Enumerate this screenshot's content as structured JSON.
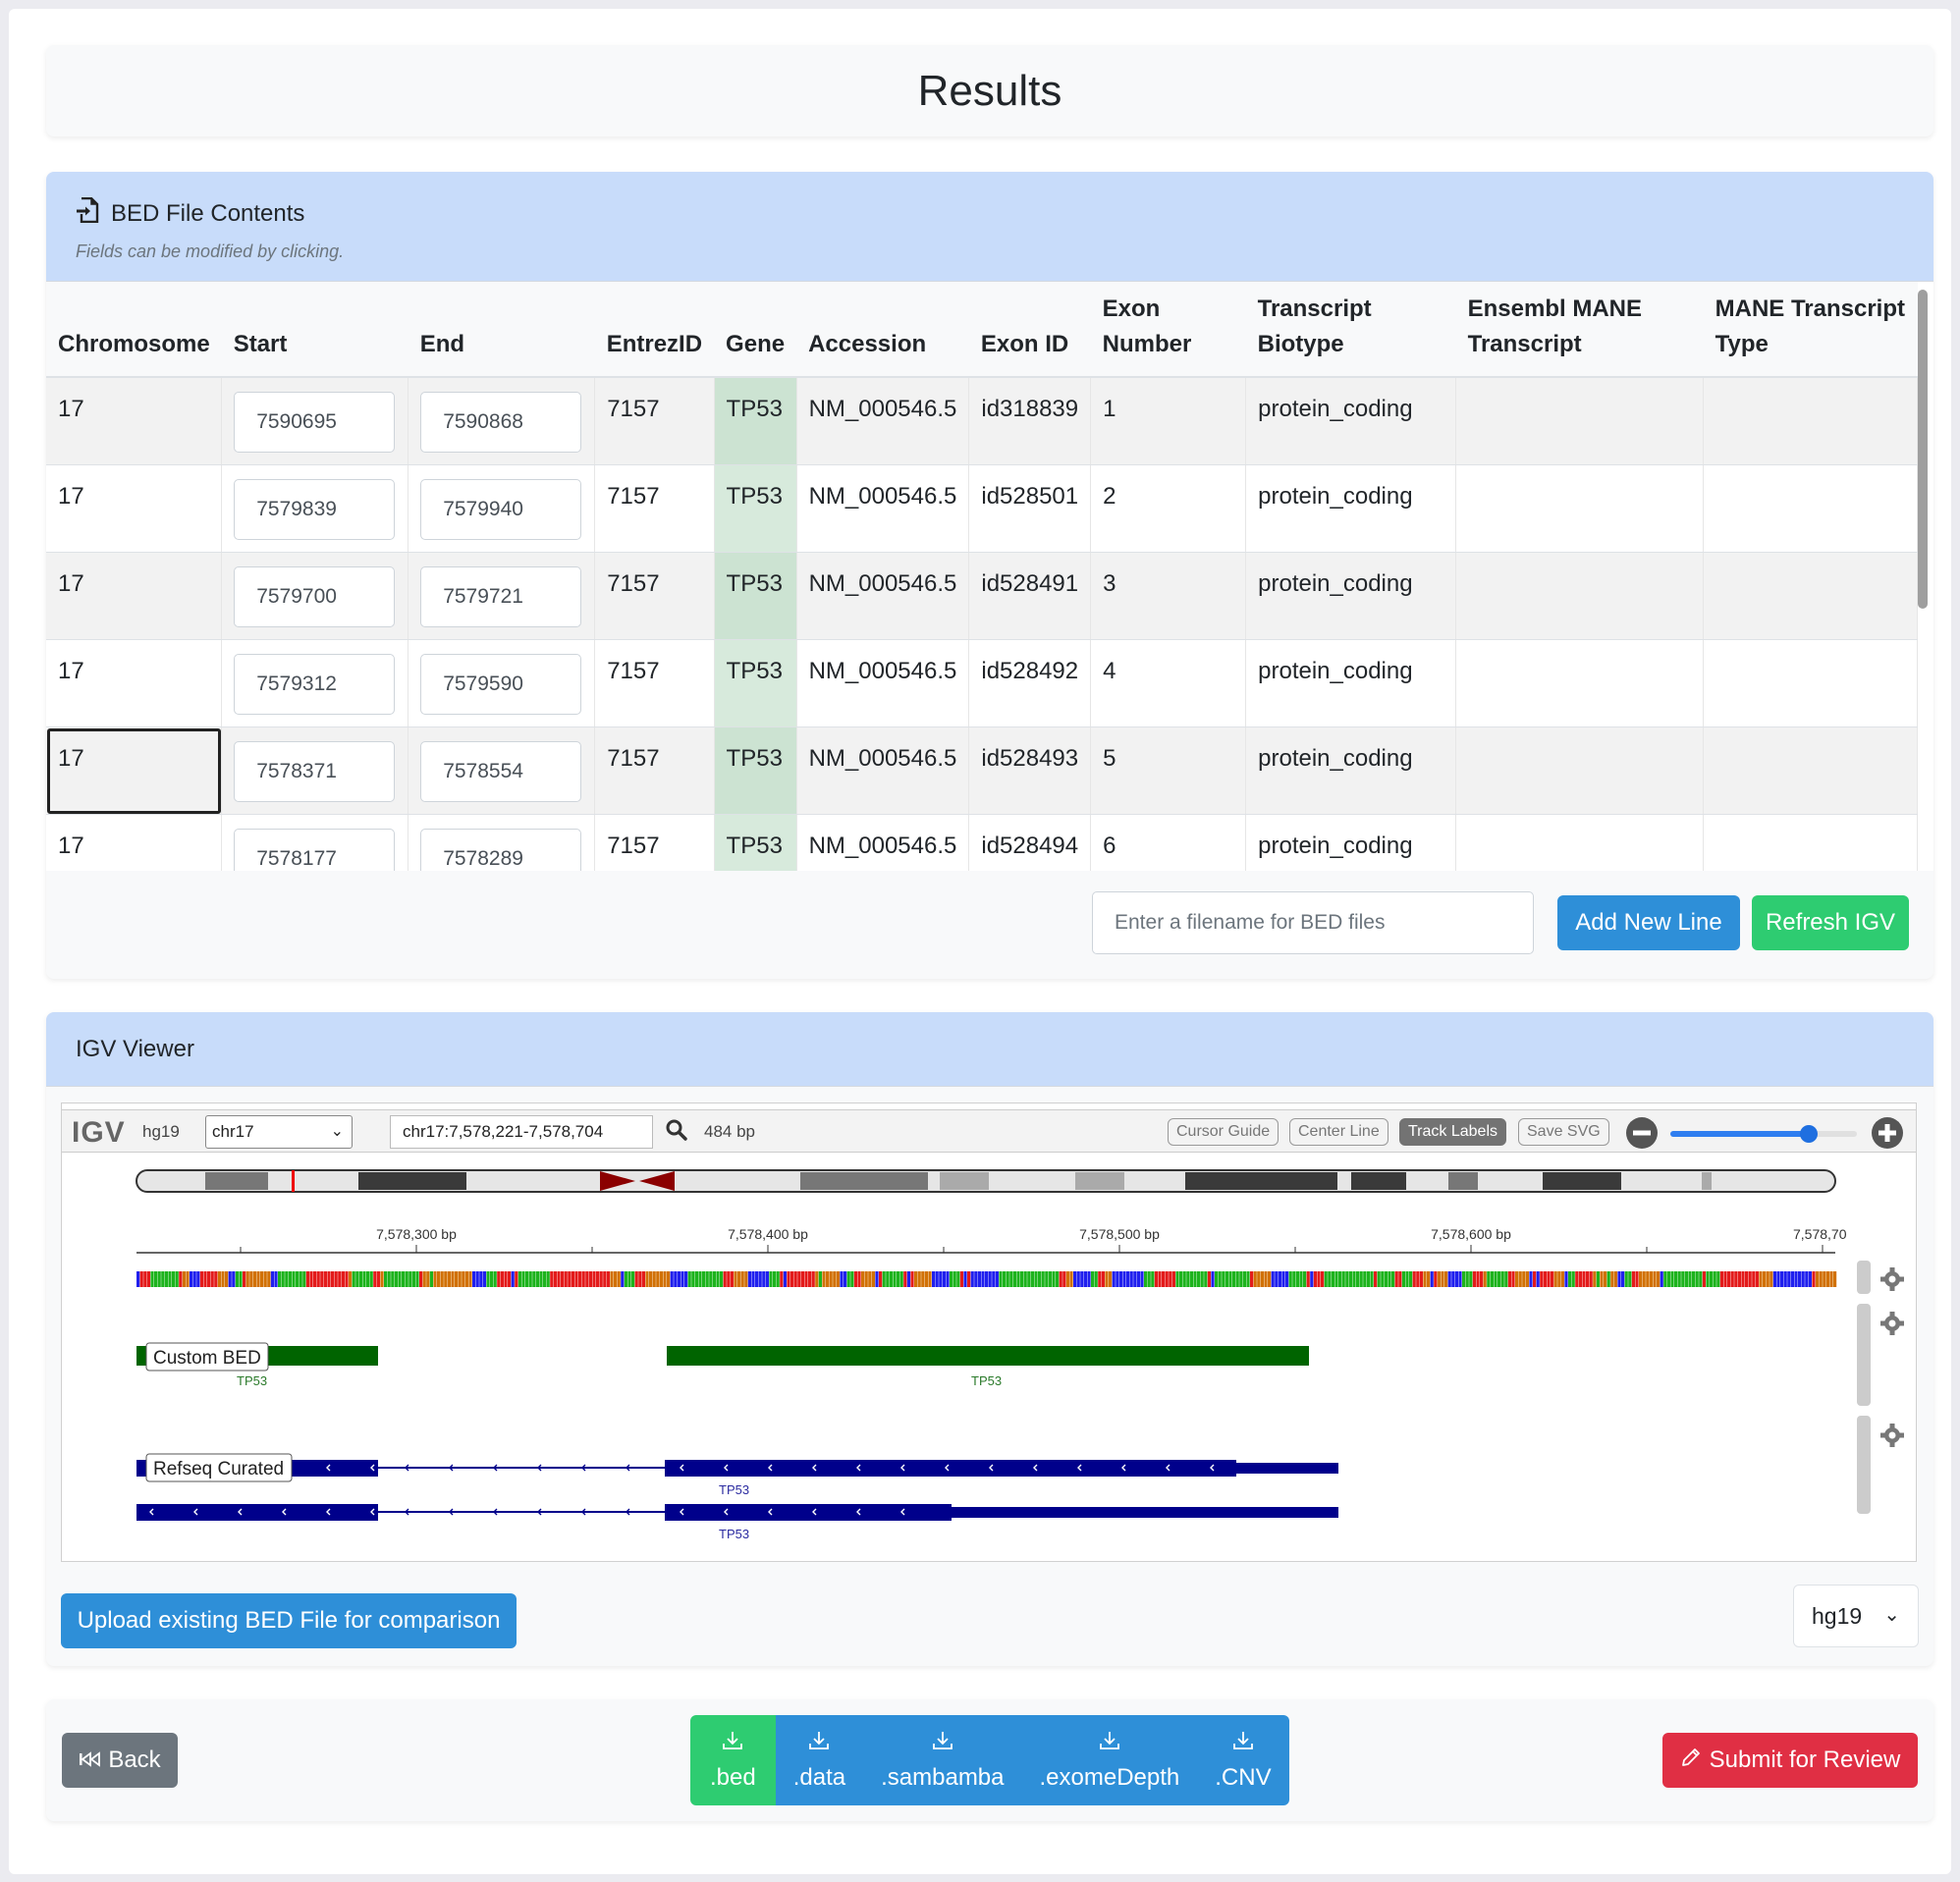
{
  "page_title": "Results",
  "bed": {
    "header_title": "BED File Contents",
    "header_subtitle": "Fields can be modified by clicking.",
    "columns": [
      "Chromosome",
      "Start",
      "End",
      "EntrezID",
      "Gene",
      "Accession",
      "Exon ID",
      "Exon Number",
      "Transcript Biotype",
      "Ensembl MANE Transcript",
      "MANE Transcript Type"
    ],
    "columns_wrapped": {
      "exon_number": [
        "Exon",
        "Number"
      ],
      "transcript_biotype": [
        "Transcript",
        "Biotype"
      ],
      "ensembl_mane": [
        "Ensembl MANE",
        "Transcript"
      ],
      "mane_type": [
        "MANE Transcript",
        "Type"
      ]
    },
    "rows": [
      {
        "chromosome": "17",
        "start": "7590695",
        "end": "7590868",
        "entrez": "7157",
        "gene": "TP53",
        "accession": "NM_000546.5",
        "exon_id": "id318839",
        "exon_number": "1",
        "biotype": "protein_coding",
        "ensembl_mane": "",
        "mane_type": ""
      },
      {
        "chromosome": "17",
        "start": "7579839",
        "end": "7579940",
        "entrez": "7157",
        "gene": "TP53",
        "accession": "NM_000546.5",
        "exon_id": "id528501",
        "exon_number": "2",
        "biotype": "protein_coding",
        "ensembl_mane": "",
        "mane_type": ""
      },
      {
        "chromosome": "17",
        "start": "7579700",
        "end": "7579721",
        "entrez": "7157",
        "gene": "TP53",
        "accession": "NM_000546.5",
        "exon_id": "id528491",
        "exon_number": "3",
        "biotype": "protein_coding",
        "ensembl_mane": "",
        "mane_type": ""
      },
      {
        "chromosome": "17",
        "start": "7579312",
        "end": "7579590",
        "entrez": "7157",
        "gene": "TP53",
        "accession": "NM_000546.5",
        "exon_id": "id528492",
        "exon_number": "4",
        "biotype": "protein_coding",
        "ensembl_mane": "",
        "mane_type": ""
      },
      {
        "chromosome": "17",
        "start": "7578371",
        "end": "7578554",
        "entrez": "7157",
        "gene": "TP53",
        "accession": "NM_000546.5",
        "exon_id": "id528493",
        "exon_number": "5",
        "biotype": "protein_coding",
        "ensembl_mane": "",
        "mane_type": ""
      },
      {
        "chromosome": "17",
        "start": "7578177",
        "end": "7578289",
        "entrez": "7157",
        "gene": "TP53",
        "accession": "NM_000546.5",
        "exon_id": "id528494",
        "exon_number": "6",
        "biotype": "protein_coding",
        "ensembl_mane": "",
        "mane_type": ""
      }
    ],
    "filename_placeholder": "Enter a filename for BED files",
    "add_line_label": "Add New Line",
    "refresh_igv_label": "Refresh IGV"
  },
  "igv": {
    "header_title": "IGV Viewer",
    "logo": "IGV",
    "genome": "hg19",
    "chromosome": "chr17",
    "locus": "chr17:7,578,221-7,578,704",
    "width_label": "484 bp",
    "buttons": [
      "Cursor Guide",
      "Center Line",
      "Track Labels",
      "Save SVG"
    ],
    "active_button": "Track Labels",
    "zoom_level": 0.75,
    "ruler_ticks": [
      "7,578,300 bp",
      "7,578,400 bp",
      "7,578,500 bp",
      "7,578,600 bp",
      "7,578,70"
    ],
    "tracks": [
      {
        "name": "Custom BED",
        "feature_label": "TP53",
        "color": "#006400"
      },
      {
        "name": "Refseq Curated",
        "feature_label": "TP53",
        "color": "#00008b"
      }
    ],
    "upload_label": "Upload existing BED File for comparison",
    "genome_select": "hg19"
  },
  "footer": {
    "back_label": "Back",
    "downloads": [
      ".bed",
      ".data",
      ".sambamba",
      ".exomeDepth",
      ".CNV"
    ],
    "submit_label": "Submit for Review"
  },
  "colors": {
    "primary": "#2e8fd8",
    "success": "#2ecc71",
    "danger": "#e02f44",
    "secondary": "#6c757d",
    "header_bg": "#c8dcfa"
  }
}
